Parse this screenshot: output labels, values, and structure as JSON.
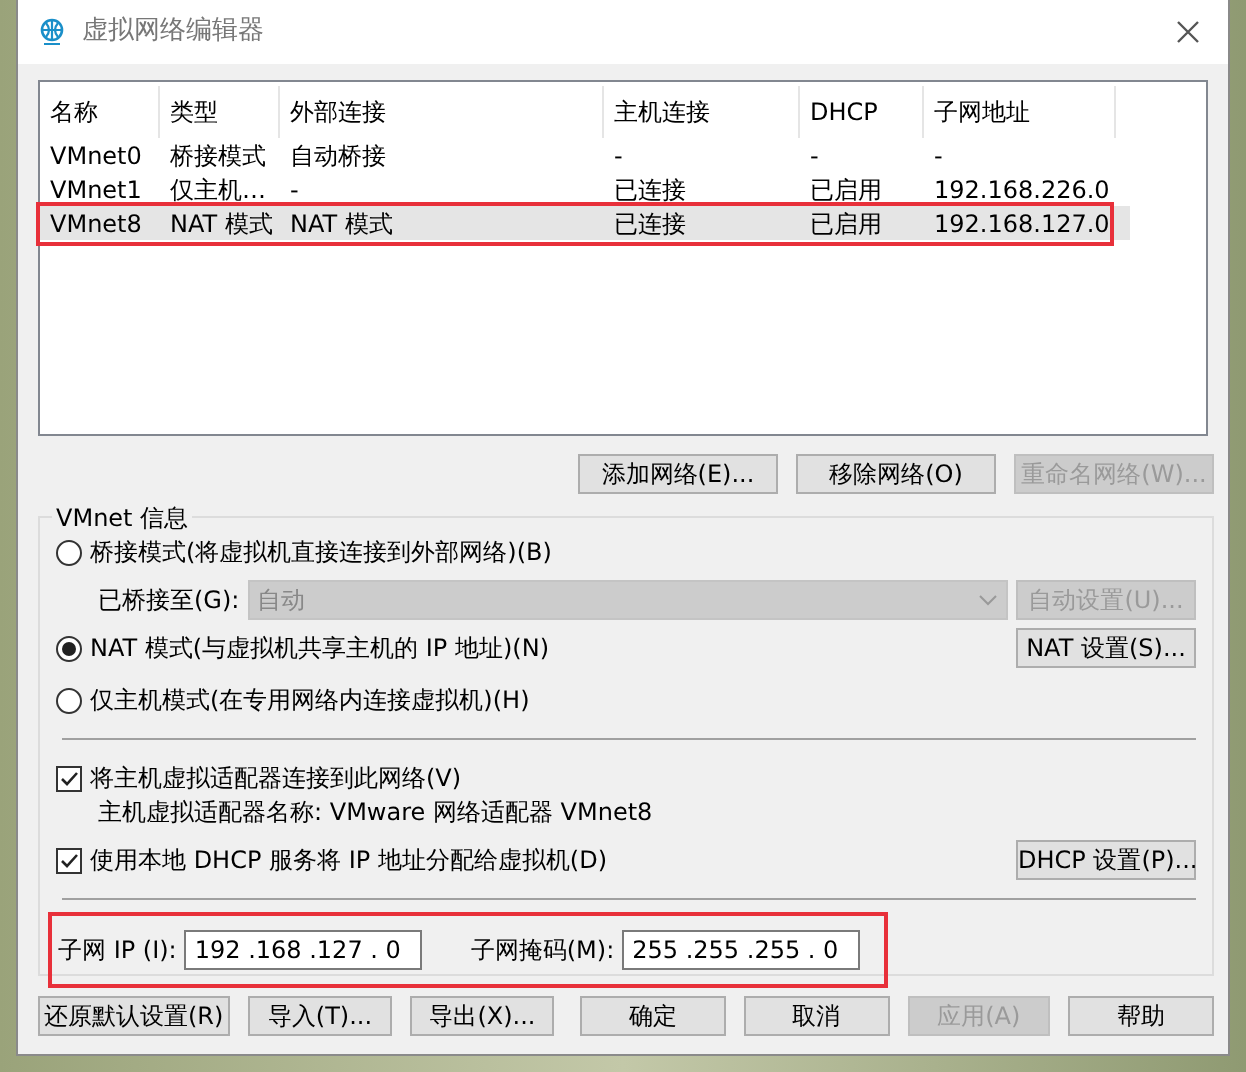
{
  "window": {
    "title": "虚拟网络编辑器"
  },
  "table": {
    "columns": [
      "名称",
      "类型",
      "外部连接",
      "主机连接",
      "DHCP",
      "子网地址"
    ],
    "rows": [
      {
        "cells": [
          "VMnet0",
          "桥接模式",
          "自动桥接",
          "-",
          "-",
          "-"
        ],
        "selected": false,
        "highlighted": false
      },
      {
        "cells": [
          "VMnet1",
          "仅主机…",
          "-",
          "已连接",
          "已启用",
          "192.168.226.0"
        ],
        "selected": false,
        "highlighted": false
      },
      {
        "cells": [
          "VMnet8",
          "NAT 模式",
          "NAT 模式",
          "已连接",
          "已启用",
          "192.168.127.0"
        ],
        "selected": true,
        "highlighted": true
      }
    ]
  },
  "network_buttons": [
    {
      "label": "添加网络(E)...",
      "disabled": false
    },
    {
      "label": "移除网络(O)",
      "disabled": false
    },
    {
      "label": "重命名网络(W)...",
      "disabled": true
    }
  ],
  "vmnet_info": {
    "title": "VMnet 信息",
    "modes": [
      {
        "label": "桥接模式(将虚拟机直接连接到外部网络)(B)",
        "selected": false
      },
      {
        "label": "NAT 模式(与虚拟机共享主机的 IP 地址)(N)",
        "selected": true
      },
      {
        "label": "仅主机模式(在专用网络内连接虚拟机)(H)",
        "selected": false
      }
    ],
    "bridged_to": {
      "label": "已桥接至(G):",
      "value": "自动",
      "disabled": true
    },
    "auto_settings_button": {
      "label": "自动设置(U)...",
      "disabled": true
    },
    "nat_settings_button": {
      "label": "NAT 设置(S)...",
      "disabled": false
    },
    "connect_adapter": {
      "label": "将主机虚拟适配器连接到此网络(V)",
      "checked": true
    },
    "adapter_name": "主机虚拟适配器名称: VMware 网络适配器 VMnet8",
    "use_dhcp": {
      "label": "使用本地 DHCP 服务将 IP 地址分配给虚拟机(D)",
      "checked": true
    },
    "dhcp_settings_button": {
      "label": "DHCP 设置(P)...",
      "disabled": false
    },
    "subnet": {
      "highlighted": true,
      "ip_label": "子网 IP (I):",
      "ip_value": "192 .168 .127 . 0",
      "mask_label": "子网掩码(M):",
      "mask_value": "255 .255 .255 . 0"
    }
  },
  "dialog_buttons": [
    {
      "label": "还原默认设置(R)",
      "disabled": false
    },
    {
      "label": "导入(T)...",
      "disabled": false
    },
    {
      "label": "导出(X)...",
      "disabled": false
    },
    {
      "label": "确定",
      "disabled": false
    },
    {
      "label": "取消",
      "disabled": false
    },
    {
      "label": "应用(A)",
      "disabled": true
    },
    {
      "label": "帮助",
      "disabled": false
    }
  ]
}
